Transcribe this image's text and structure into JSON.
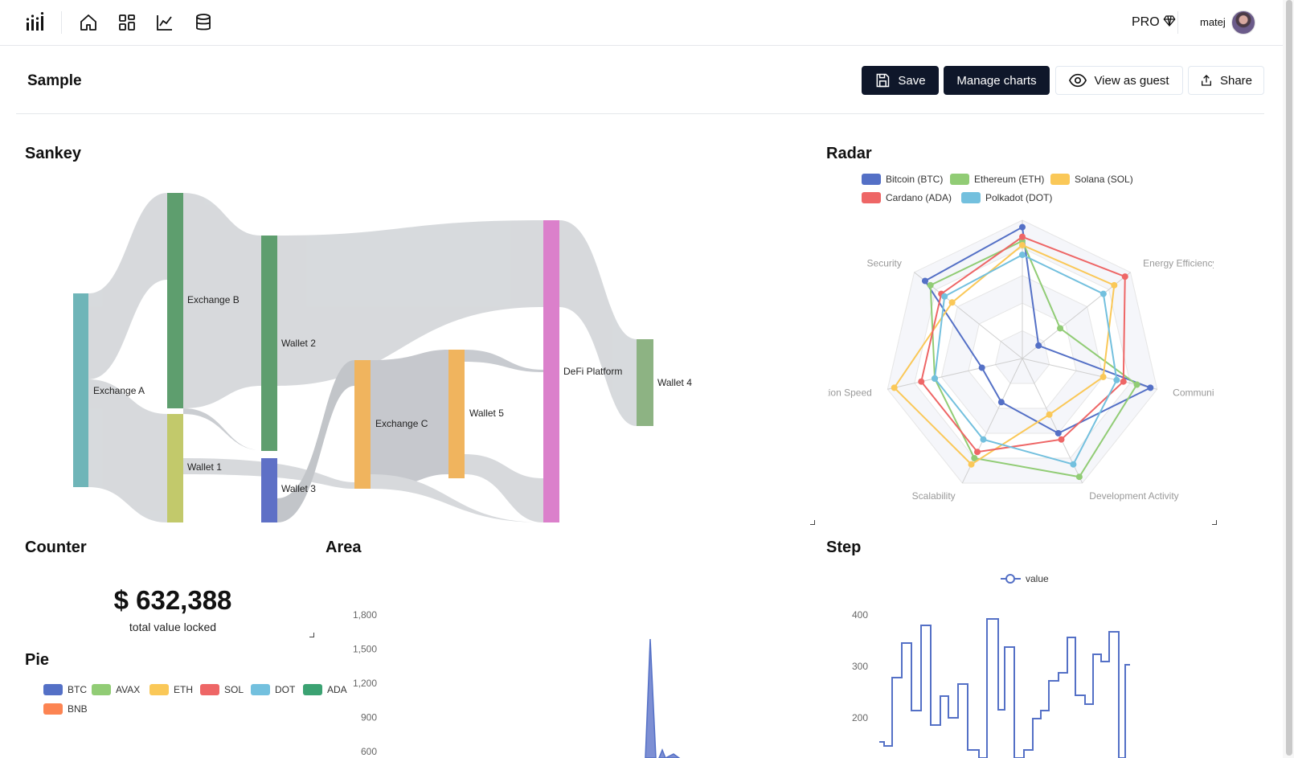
{
  "header": {
    "nav_icons": [
      "bar-chart-logo-icon",
      "home-icon",
      "dashboard-icon",
      "line-chart-icon",
      "database-icon"
    ],
    "pro_label": "PRO",
    "username": "matej"
  },
  "page": {
    "title": "Sample",
    "buttons": {
      "save": "Save",
      "manage": "Manage charts",
      "guest": "View as guest",
      "share": "Share"
    }
  },
  "sections": {
    "sankey": "Sankey",
    "radar": "Radar",
    "counter": "Counter",
    "area": "Area",
    "step": "Step",
    "pie": "Pie"
  },
  "counter": {
    "value": "$ 632,388",
    "label": "total value locked"
  },
  "colors": {
    "btc": "#5470c6",
    "eth": "#91cc75",
    "sol": "#fac858",
    "ada": "#ee6666",
    "dot": "#73c0de",
    "green": "#3ba272",
    "bnb": "#fc8452",
    "pink": "#d97fc9",
    "link": "#d5d8db"
  },
  "chart_data": [
    {
      "type": "sankey",
      "title": "Sankey",
      "nodes": [
        "Exchange A",
        "Exchange B",
        "Wallet 1",
        "Wallet 2",
        "Wallet 3",
        "Exchange C",
        "Wallet 5",
        "DeFi Platform",
        "Wallet 4"
      ]
    },
    {
      "type": "radar",
      "title": "Radar",
      "indicators": [
        "",
        "Energy Efficiency",
        "Community",
        "Development Activity",
        "Scalability",
        "Transaction Speed",
        "Security"
      ],
      "legend": [
        "Bitcoin (BTC)",
        "Ethereum (ETH)",
        "Solana (SOL)",
        "Cardano (ADA)",
        "Polkadot (DOT)"
      ],
      "series": [
        {
          "name": "Bitcoin (BTC)",
          "values": [
            95,
            15,
            95,
            60,
            35,
            30,
            90
          ]
        },
        {
          "name": "Ethereum (ETH)",
          "values": [
            85,
            35,
            85,
            95,
            80,
            65,
            85
          ]
        },
        {
          "name": "Solana (SOL)",
          "values": [
            82,
            85,
            60,
            45,
            85,
            95,
            65
          ]
        },
        {
          "name": "Cardano (ADA)",
          "values": [
            88,
            95,
            75,
            65,
            75,
            75,
            75
          ]
        },
        {
          "name": "Polkadot (DOT)",
          "values": [
            75,
            75,
            70,
            85,
            65,
            65,
            72
          ]
        }
      ]
    },
    {
      "type": "area",
      "title": "Area",
      "y_ticks": [
        "1,800",
        "1,500",
        "1,200",
        "900",
        "600"
      ]
    },
    {
      "type": "line",
      "title": "Step",
      "legend": [
        "value"
      ],
      "y_ticks": [
        "400",
        "300",
        "200"
      ]
    },
    {
      "type": "pie",
      "title": "Pie",
      "legend": [
        "BTC",
        "AVAX",
        "ETH",
        "SOL",
        "DOT",
        "ADA",
        "BNB"
      ]
    }
  ]
}
